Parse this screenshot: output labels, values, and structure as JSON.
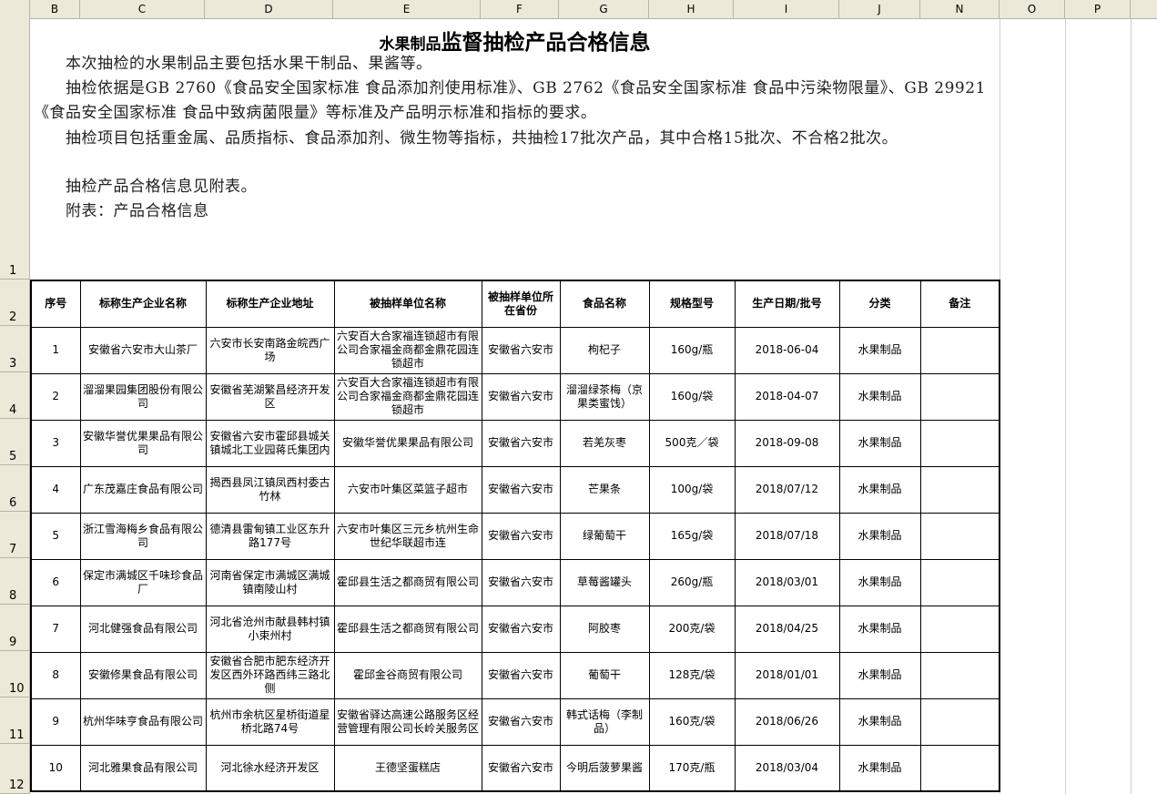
{
  "columns": [
    "B",
    "C",
    "D",
    "E",
    "F",
    "G",
    "H",
    "I",
    "J",
    "N",
    "O",
    "P"
  ],
  "rows": [
    "1",
    "2",
    "3",
    "4",
    "5",
    "6",
    "7",
    "8",
    "9",
    "10",
    "11",
    "12"
  ],
  "intro": {
    "title_small": "水果制品",
    "title_big": "监督抽检产品合格信息",
    "p1": "　　本次抽检的水果制品主要包括水果干制品、果酱等。",
    "p2": "　　抽检依据是GB 2760《食品安全国家标准 食品添加剂使用标准》、GB 2762《食品安全国家标准 食品中污染物限量》、GB 29921《食品安全国家标准 食品中致病菌限量》等标准及产品明示标准和指标的要求。",
    "p3": "　　抽检项目包括重金属、品质指标、食品添加剂、微生物等指标，共抽检17批次产品，其中合格15批次、不合格2批次。",
    "p4": "　　抽检产品合格信息见附表。",
    "p5": "　　附表：产品合格信息"
  },
  "table": {
    "headers": [
      "序号",
      "标称生产企业名称",
      "标称生产企业地址",
      "被抽样单位名称",
      "被抽样单位所在省份",
      "食品名称",
      "规格型号",
      "生产日期/批号",
      "分类",
      "备注"
    ],
    "rows": [
      [
        "1",
        "安徽省六安市大山茶厂",
        "六安市长安南路金皖西广场",
        "六安百大合家福连锁超市有限公司合家福金商都金鼎花园连锁超市",
        "安徽省六安市",
        "枸杞子",
        "160g/瓶",
        "2018-06-04",
        "水果制品",
        ""
      ],
      [
        "2",
        "溜溜果园集团股份有限公司",
        "安徽省芜湖繁昌经济开发区",
        "六安百大合家福连锁超市有限公司合家福金商都金鼎花园连锁超市",
        "安徽省六安市",
        "溜溜绿茶梅（京果类蜜饯）",
        "160g/袋",
        "2018-04-07",
        "水果制品",
        ""
      ],
      [
        "3",
        "安徽华誉优果果品有限公司",
        "安徽省六安市霍邱县城关镇城北工业园蒋氏集团内",
        "安徽华誉优果果品有限公司",
        "安徽省六安市",
        "若羌灰枣",
        "500克／袋",
        "2018-09-08",
        "水果制品",
        ""
      ],
      [
        "4",
        "广东茂嘉庄食品有限公司",
        "揭西县凤江镇凤西村委古竹林",
        "六安市叶集区菜篮子超市",
        "安徽省六安市",
        "芒果条",
        "100g/袋",
        "2018/07/12",
        "水果制品",
        ""
      ],
      [
        "5",
        "浙江雪海梅乡食品有限公司",
        "德清县雷甸镇工业区东升路177号",
        "六安市叶集区三元乡杭州生命世纪华联超市连",
        "安徽省六安市",
        "绿葡萄干",
        "165g/袋",
        "2018/07/18",
        "水果制品",
        ""
      ],
      [
        "6",
        "保定市满城区千味珍食品厂",
        "河南省保定市满城区满城镇南陵山村",
        "霍邱县生活之都商贸有限公司",
        "安徽省六安市",
        "草莓酱罐头",
        "260g/瓶",
        "2018/03/01",
        "水果制品",
        ""
      ],
      [
        "7",
        "河北健强食品有限公司",
        "河北省沧州市献县韩村镇小束州村",
        "霍邱县生活之都商贸有限公司",
        "安徽省六安市",
        "阿胶枣",
        "200克/袋",
        "2018/04/25",
        "水果制品",
        ""
      ],
      [
        "8",
        "安徽修果食品有限公司",
        "安徽省合肥市肥东经济开发区西外环路西纬三路北侧",
        "霍邱金谷商贸有限公司",
        "安徽省六安市",
        "葡萄干",
        "128克/袋",
        "2018/01/01",
        "水果制品",
        ""
      ],
      [
        "9",
        "杭州华味亨食品有限公司",
        "杭州市余杭区星桥街道星桥北路74号",
        "安徽省驿达高速公路服务区经营管理有限公司长岭关服务区",
        "安徽省六安市",
        "韩式话梅（李制品）",
        "160克/袋",
        "2018/06/26",
        "水果制品",
        ""
      ],
      [
        "10",
        "河北雅果食品有限公司",
        "河北徐水经济开发区",
        "王德坚蛋糕店",
        "安徽省六安市",
        "今明后菠萝果酱",
        "170克/瓶",
        "2018/03/04",
        "水果制品",
        ""
      ]
    ]
  },
  "colors": {
    "header_bg": "#ece9d8",
    "grid": "#d0d0d0"
  }
}
